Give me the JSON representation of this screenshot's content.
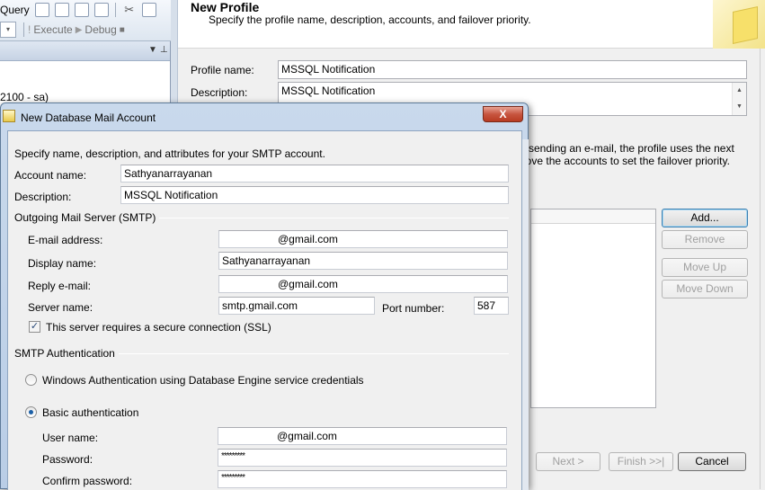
{
  "ssms": {
    "query_label": "Query",
    "execute_label": "Execute",
    "debug_label": "Debug",
    "server_node_text": "2100 - sa)"
  },
  "wizard": {
    "title": "New Profile",
    "subtitle": "Specify the profile name, description, accounts, and failover priority.",
    "profile_name_label": "Profile name:",
    "profile_name_value": "MSSQL Notification",
    "description_label": "Description:",
    "description_value": "MSSQL Notification",
    "instructions_line1": "e sending an e-mail, the profile uses the next",
    "instructions_line2": "nove the accounts to set the failover priority.",
    "buttons": {
      "add": "Add...",
      "remove": "Remove",
      "move_up": "Move Up",
      "move_down": "Move Down",
      "next": "Next >",
      "finish": "Finish >>|",
      "cancel": "Cancel"
    }
  },
  "mail_dialog": {
    "title": "New Database Mail Account",
    "close_glyph": "X",
    "intro": "Specify name, description, and attributes for your SMTP account.",
    "account_name_label": "Account name:",
    "account_name_value": "Sathyanarrayanan",
    "description_label": "Description:",
    "description_value": "MSSQL Notification",
    "smtp_group_title": "Outgoing Mail Server (SMTP)",
    "email_label": "E-mail address:",
    "email_value": "@gmail.com",
    "display_name_label": "Display name:",
    "display_name_value": "Sathyanarrayanan",
    "reply_label": "Reply e-mail:",
    "reply_value": "@gmail.com",
    "server_name_label": "Server name:",
    "server_name_value": "smtp.gmail.com",
    "port_label": "Port number:",
    "port_value": "587",
    "ssl_label": "This server requires a secure connection (SSL)",
    "ssl_checked": true,
    "auth_group_title": "SMTP Authentication",
    "windows_auth_label": "Windows Authentication using Database Engine service credentials",
    "basic_auth_label": "Basic authentication",
    "user_name_label": "User name:",
    "user_name_value": "@gmail.com",
    "password_label": "Password:",
    "password_value": "*********",
    "confirm_password_label": "Confirm password:",
    "confirm_password_value": "*********"
  }
}
